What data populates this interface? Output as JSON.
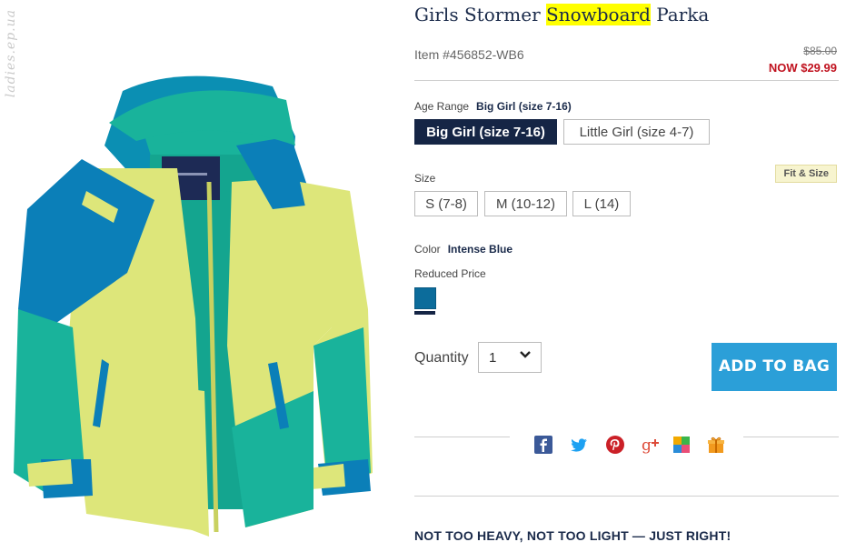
{
  "product": {
    "title_before": "Girls Stormer ",
    "title_highlight": "Snowboard",
    "title_after": " Parka",
    "item_number": "Item #456852-WB6",
    "was_price": "$85.00",
    "now_price": "NOW $29.99"
  },
  "watermark": "ladies.ep.ua",
  "age_range": {
    "label": "Age Range",
    "selected_value": "Big Girl (size 7-16)",
    "options": [
      "Big Girl (size 7-16)",
      "Little Girl (size 4-7)"
    ]
  },
  "size": {
    "label": "Size",
    "fit_link": "Fit & Size",
    "options": [
      "S (7-8)",
      "M (10-12)",
      "L (14)"
    ]
  },
  "color": {
    "label": "Color",
    "selected_value": "Intense Blue",
    "price_note": "Reduced Price",
    "swatch_hex": "#0c6c9b"
  },
  "quantity": {
    "label": "Quantity",
    "value": "1"
  },
  "add_to_bag": "ADD TO BAG",
  "social_icons": [
    "facebook-icon",
    "twitter-icon",
    "pinterest-icon",
    "google-plus-icon",
    "multi-share-icon",
    "gift-icon"
  ],
  "tagline": "NOT TOO HEAVY, NOT TOO LIGHT — JUST RIGHT!",
  "colors": {
    "accent": "#2b9fd8",
    "navy": "#152545",
    "sale_red": "#c0121f"
  }
}
